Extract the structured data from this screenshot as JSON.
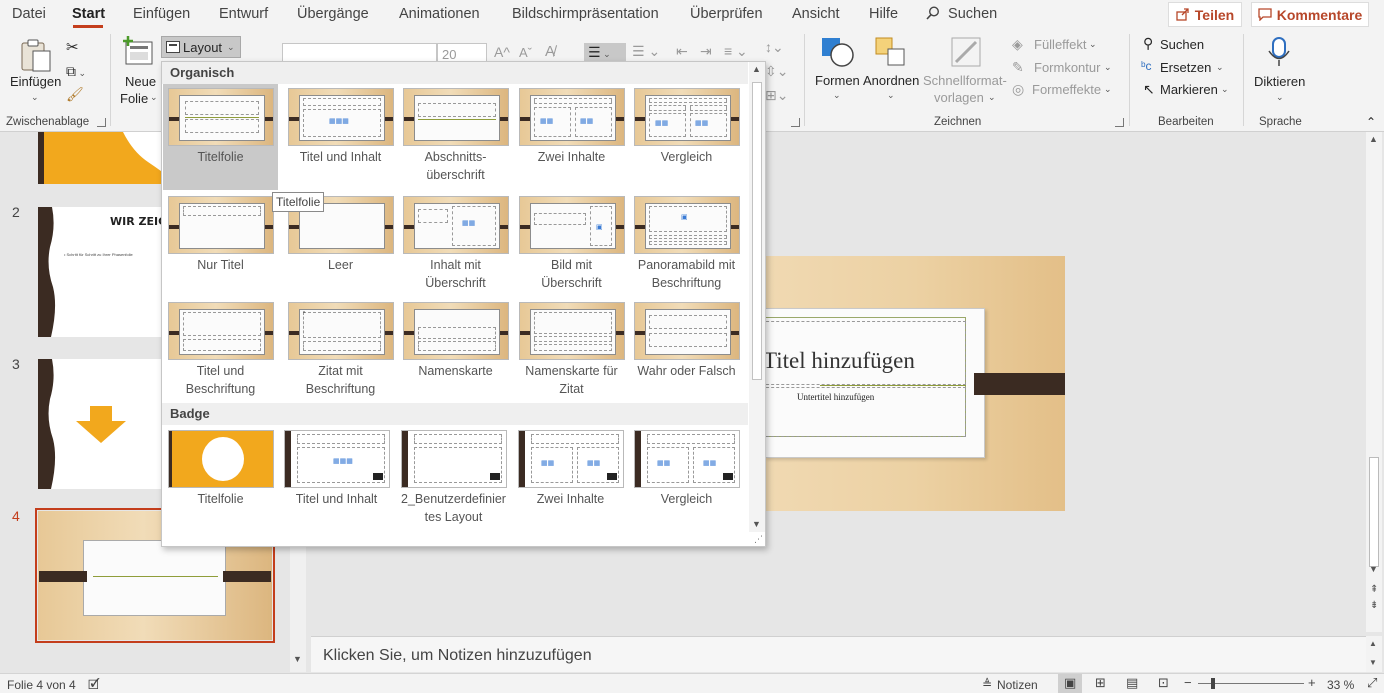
{
  "menu": {
    "tabs": [
      "Datei",
      "Start",
      "Einfügen",
      "Entwurf",
      "Übergänge",
      "Animationen",
      "Bildschirmpräsentation",
      "Überprüfen",
      "Ansicht",
      "Hilfe"
    ],
    "search": "Suchen",
    "share": "Teilen",
    "comments": "Kommentare"
  },
  "ribbon": {
    "paste": "Einfügen",
    "clipboard_group": "Zwischenablage",
    "new_slide_line1": "Neue",
    "new_slide_line2": "Folie",
    "layout": "Layout",
    "font_size": "20",
    "shapes": "Formen",
    "arrange": "Anordnen",
    "quick_styles_line1": "Schnellformat-",
    "quick_styles_line2": "vorlagen",
    "fill": "Fülleffekt",
    "outline": "Formkontur",
    "effects": "Formeffekte",
    "drawing_group": "Zeichnen",
    "find": "Suchen",
    "replace": "Ersetzen",
    "select": "Markieren",
    "editing_group": "Bearbeiten",
    "dictate": "Diktieren",
    "voice_group": "Sprache"
  },
  "dropdown": {
    "section1": "Organisch",
    "section2": "Badge",
    "organic": [
      {
        "l1": "Titelfolie",
        "l2": ""
      },
      {
        "l1": "Titel und Inhalt",
        "l2": ""
      },
      {
        "l1": "Abschnitts-",
        "l2": "überschrift"
      },
      {
        "l1": "Zwei Inhalte",
        "l2": ""
      },
      {
        "l1": "Vergleich",
        "l2": ""
      },
      {
        "l1": "Nur Titel",
        "l2": ""
      },
      {
        "l1": "Leer",
        "l2": ""
      },
      {
        "l1": "Inhalt mit",
        "l2": "Überschrift"
      },
      {
        "l1": "Bild mit",
        "l2": "Überschrift"
      },
      {
        "l1": "Panoramabild mit",
        "l2": "Beschriftung"
      },
      {
        "l1": "Titel und",
        "l2": "Beschriftung"
      },
      {
        "l1": "Zitat mit",
        "l2": "Beschriftung"
      },
      {
        "l1": "Namenskarte",
        "l2": ""
      },
      {
        "l1": "Namenskarte für",
        "l2": "Zitat"
      },
      {
        "l1": "Wahr oder Falsch",
        "l2": ""
      }
    ],
    "badge": [
      {
        "l1": "Titelfolie",
        "l2": ""
      },
      {
        "l1": "Titel und Inhalt",
        "l2": ""
      },
      {
        "l1": "2_Benutzerdefinier",
        "l2": "tes Layout"
      },
      {
        "l1": "Zwei Inhalte",
        "l2": ""
      },
      {
        "l1": "Vergleich",
        "l2": ""
      }
    ],
    "tooltip": "Titelfolie"
  },
  "thumbnails": {
    "numbers": [
      "2",
      "3",
      "4"
    ],
    "slide2_title": "WIR ZEIGE",
    "slide2_bullet": "• Schritt für Schritt zu Ihrer Phasenfolie"
  },
  "slide": {
    "title": "Titel hinzufügen",
    "subtitle": "Untertitel hinzufügen"
  },
  "notes": "Klicken Sie, um Notizen hinzuzufügen",
  "status": {
    "slide_info": "Folie 4 von 4",
    "notes": "Notizen",
    "zoom": "33 %"
  },
  "colors": {
    "accent": "#c43e1c",
    "share": "#b7472a",
    "badge_yellow": "#f2a81d",
    "dark_brown": "#3b2b22"
  }
}
